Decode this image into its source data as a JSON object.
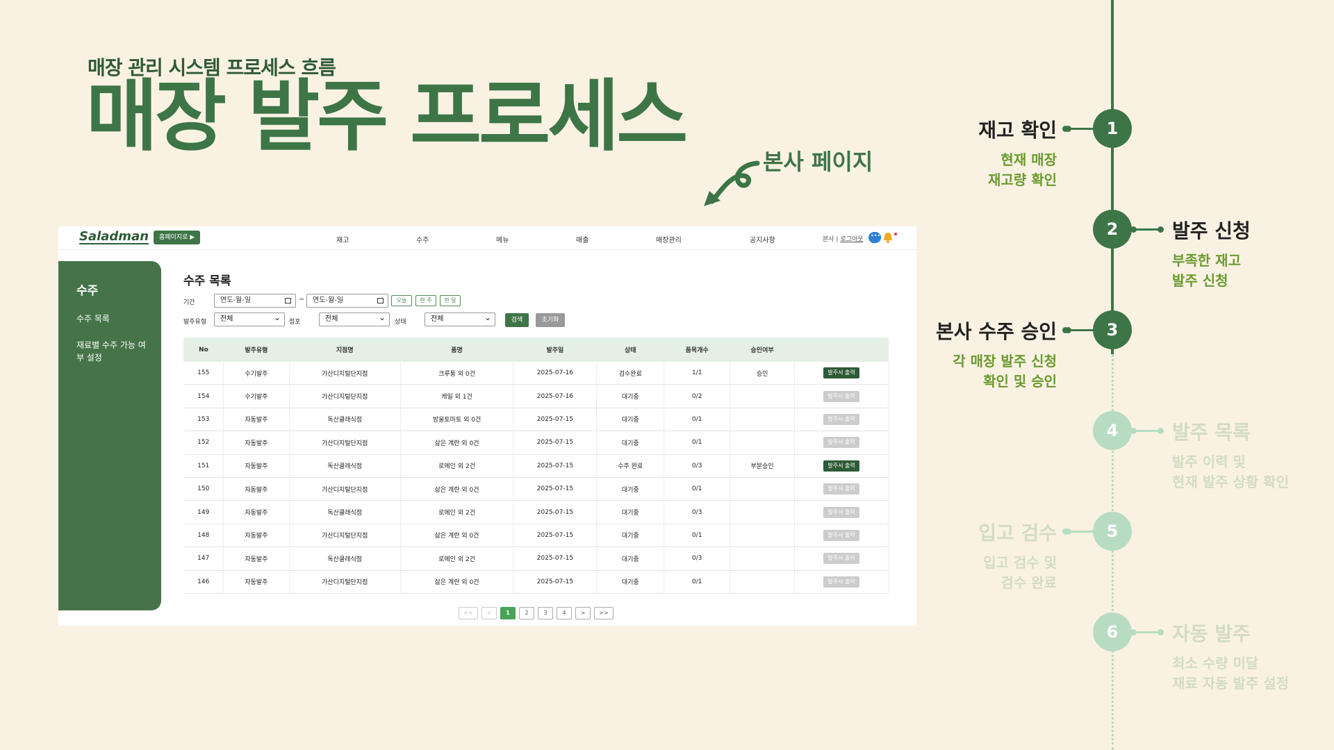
{
  "slide": {
    "subtitle": "매장 관리 시스템 프로세스 흐름",
    "title": "매장 발주 프로세스",
    "hq_label": "본사 페이지"
  },
  "app": {
    "logo": "Saladman",
    "home_button": "홈페이지로 ▶",
    "nav": [
      "재고",
      "수주",
      "메뉴",
      "매출",
      "매장관리",
      "공지사항"
    ],
    "user": {
      "role": "본사",
      "separator": " | ",
      "logout": "로그아웃"
    },
    "sidebar": {
      "title": "수주",
      "items": [
        "수주 목록",
        "재료별 수주 가능 여부 설정"
      ]
    },
    "content_title": "수주 목록",
    "filters": {
      "period_label": "기간",
      "date_placeholder": "연도-월-일",
      "tilde": "~",
      "quick": [
        "오늘",
        "한 주",
        "한 달"
      ],
      "type_label": "발주유형",
      "type_value": "전체",
      "store_label": "점포",
      "store_value": "전체",
      "status_label": "상태",
      "status_value": "전체",
      "search": "검색",
      "reset": "초기화"
    },
    "table": {
      "headers": [
        "No",
        "발주유형",
        "지점명",
        "품명",
        "발주일",
        "상태",
        "품목개수",
        "승인여부",
        ""
      ],
      "print_label": "발주서 출력",
      "rows": [
        {
          "no": "155",
          "type": "수기발주",
          "store": "가산디지털단지점",
          "item": "크루통 외 0건",
          "date": "2025-07-16",
          "status": "검수완료",
          "count": "1/1",
          "approval": "승인",
          "print_active": true
        },
        {
          "no": "154",
          "type": "수기발주",
          "store": "가산디지털단지점",
          "item": "케일 외 1건",
          "date": "2025-07-16",
          "status": "대기중",
          "count": "0/2",
          "approval": "",
          "print_active": false
        },
        {
          "no": "153",
          "type": "자동발주",
          "store": "독산클래식점",
          "item": "방울토마토 외 0건",
          "date": "2025-07-15",
          "status": "대기중",
          "count": "0/1",
          "approval": "",
          "print_active": false
        },
        {
          "no": "152",
          "type": "자동발주",
          "store": "가산디지털단지점",
          "item": "삶은 계란 외 0건",
          "date": "2025-07-15",
          "status": "대기중",
          "count": "0/1",
          "approval": "",
          "print_active": false
        },
        {
          "no": "151",
          "type": "자동발주",
          "store": "독산클래식점",
          "item": "로메인 외 2건",
          "date": "2025-07-15",
          "status": "수주 완료",
          "count": "0/3",
          "approval": "부분승인",
          "print_active": true
        },
        {
          "no": "150",
          "type": "자동발주",
          "store": "가산디지털단지점",
          "item": "삶은 계란 외 0건",
          "date": "2025-07-15",
          "status": "대기중",
          "count": "0/1",
          "approval": "",
          "print_active": false
        },
        {
          "no": "149",
          "type": "자동발주",
          "store": "독산클래식점",
          "item": "로메인 외 2건",
          "date": "2025-07-15",
          "status": "대기중",
          "count": "0/3",
          "approval": "",
          "print_active": false
        },
        {
          "no": "148",
          "type": "자동발주",
          "store": "가산디지털단지점",
          "item": "삶은 계란 외 0건",
          "date": "2025-07-15",
          "status": "대기중",
          "count": "0/1",
          "approval": "",
          "print_active": false
        },
        {
          "no": "147",
          "type": "자동발주",
          "store": "독산클래식점",
          "item": "로메인 외 2건",
          "date": "2025-07-15",
          "status": "대기중",
          "count": "0/3",
          "approval": "",
          "print_active": false
        },
        {
          "no": "146",
          "type": "자동발주",
          "store": "가산디지털단지점",
          "item": "삶은 계란 외 0건",
          "date": "2025-07-15",
          "status": "대기중",
          "count": "0/1",
          "approval": "",
          "print_active": false
        }
      ]
    },
    "pagination": [
      "<<",
      "<",
      "1",
      "2",
      "3",
      "4",
      ">",
      ">>"
    ],
    "current_page": "1"
  },
  "timeline": {
    "steps": [
      {
        "num": "1",
        "title": "재고 확인",
        "desc1": "현재 매장",
        "desc2": "재고량 확인",
        "active": true
      },
      {
        "num": "2",
        "title": "발주 신청",
        "desc1": "부족한 재고",
        "desc2": "발주 신청",
        "active": true
      },
      {
        "num": "3",
        "title": "본사 수주 승인",
        "desc1": "각 매장 발주 신청",
        "desc2": "확인 및 승인",
        "active": true
      },
      {
        "num": "4",
        "title": "발주 목록",
        "desc1": "발주 이력 및",
        "desc2": "현재 발주 상황 확인",
        "active": false
      },
      {
        "num": "5",
        "title": "입고 검수",
        "desc1": "입고 검수 및",
        "desc2": "검수 완료",
        "active": false
      },
      {
        "num": "6",
        "title": "자동 발주",
        "desc1": "최소 수량 미달",
        "desc2": "재료 자동 발주 설정",
        "active": false
      }
    ]
  },
  "colors": {
    "primary": "#3d7547",
    "inactive": "#b7dcc1",
    "background": "#f9f2e3"
  }
}
